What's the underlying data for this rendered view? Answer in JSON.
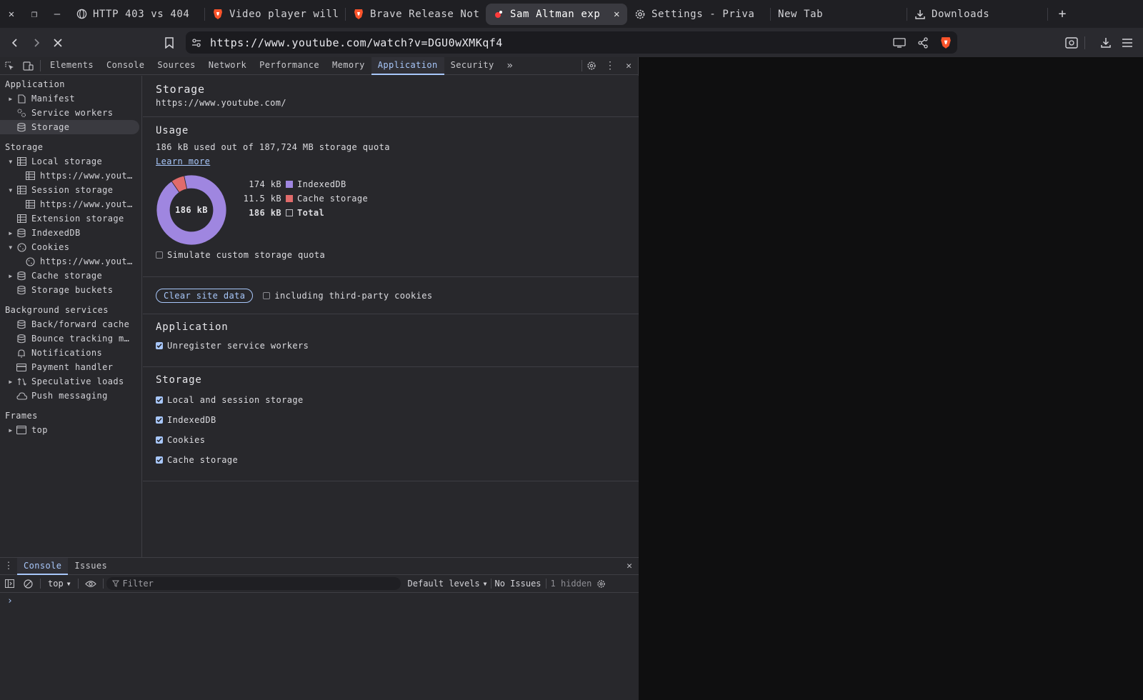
{
  "browser": {
    "tabs": [
      {
        "label": "HTTP 403 vs 404",
        "icon": "globe-icon"
      },
      {
        "label": "Video player will",
        "icon": "brave-icon"
      },
      {
        "label": "Brave Release Not",
        "icon": "brave-icon"
      },
      {
        "label": "Sam Altman exp",
        "icon": "youtube-icon",
        "active": true
      },
      {
        "label": "Settings - Priva",
        "icon": "gear-icon"
      },
      {
        "label": "New Tab",
        "icon": ""
      }
    ],
    "downloads_label": "Downloads",
    "url": "https://www.youtube.com/watch?v=DGU0wXMKqf4"
  },
  "devtools": {
    "tabs": [
      "Elements",
      "Console",
      "Sources",
      "Network",
      "Performance",
      "Memory",
      "Application",
      "Security"
    ],
    "active_tab": "Application",
    "sidebar": {
      "application_heading": "Application",
      "application_items": [
        "Manifest",
        "Service workers",
        "Storage"
      ],
      "storage_heading": "Storage",
      "local_storage": "Local storage",
      "local_storage_child": "https://www.yout…",
      "session_storage": "Session storage",
      "session_storage_child": "https://www.yout…",
      "extension_storage": "Extension storage",
      "indexeddb": "IndexedDB",
      "cookies": "Cookies",
      "cookies_child": "https://www.yout…",
      "cache_storage": "Cache storage",
      "storage_buckets": "Storage buckets",
      "background_heading": "Background services",
      "background_items": [
        "Back/forward cache",
        "Bounce tracking m…",
        "Notifications",
        "Payment handler",
        "Speculative loads",
        "Push messaging"
      ],
      "frames_heading": "Frames",
      "frames_top": "top"
    },
    "main": {
      "title": "Storage",
      "origin": "https://www.youtube.com/",
      "usage_heading": "Usage",
      "usage_text": "186 kB used out of 187,724 MB storage quota",
      "learn_more": "Learn more",
      "donut_label": "186 kB",
      "legend": [
        {
          "value": "174 kB",
          "label": "IndexedDB",
          "color": "#9f86e0"
        },
        {
          "value": "11.5 kB",
          "label": "Cache storage",
          "color": "#e06b6b"
        },
        {
          "value": "186 kB",
          "label": "Total",
          "color": ""
        }
      ],
      "simulate_quota": "Simulate custom storage quota",
      "clear_button": "Clear site data",
      "third_party": "including third-party cookies",
      "application_heading": "Application",
      "unregister_sw": "Unregister service workers",
      "storage_heading": "Storage",
      "storage_options": [
        "Local and session storage",
        "IndexedDB",
        "Cookies",
        "Cache storage"
      ]
    },
    "drawer": {
      "tabs": [
        "Console",
        "Issues"
      ],
      "context": "top",
      "filter_placeholder": "Filter",
      "levels": "Default levels",
      "no_issues": "No Issues",
      "hidden": "1 hidden",
      "prompt": "›"
    }
  },
  "chart_data": {
    "type": "pie",
    "categories": [
      "IndexedDB",
      "Cache storage"
    ],
    "values": [
      174,
      11.5
    ],
    "unit": "kB",
    "total": 186,
    "colors": [
      "#9f86e0",
      "#e06b6b"
    ]
  }
}
